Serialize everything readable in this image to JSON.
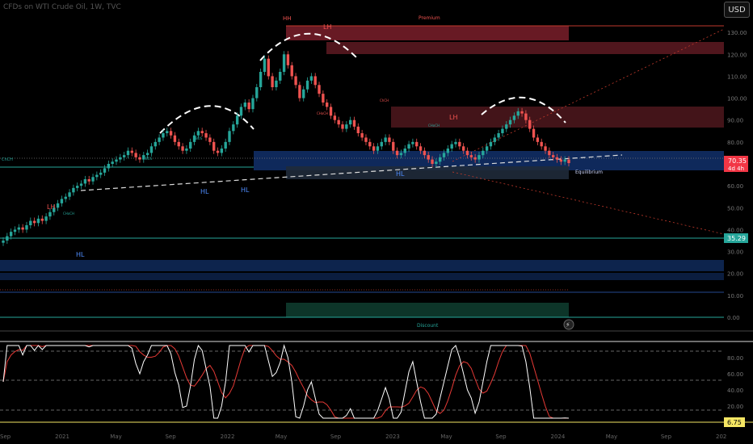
{
  "header": {
    "symbol_title": "CFDs on WTI Crude Oil, 1W, TVC",
    "currency_button": "USD"
  },
  "colors": {
    "up_candle": "#26a69a",
    "down_candle": "#ef5350",
    "premium_zone": "#7a1f2a",
    "discount_zone": "#0e3b2e",
    "equilibrium_zone": "#12306b",
    "oscillator_fast": "#ffffff",
    "oscillator_slow": "#e53935",
    "last_price_badge": "#f23645",
    "level_badge": "#26a69a",
    "osc_badge": "#f5e663"
  },
  "chart_data": {
    "type": "candlestick",
    "price_axis": {
      "ticks": [
        "130.00",
        "120.00",
        "110.00",
        "100.00",
        "90.00",
        "80.00",
        "70.00",
        "60.00",
        "50.00",
        "40.00",
        "30.00",
        "20.00",
        "10.00",
        "0.00"
      ],
      "ylim": [
        0,
        133
      ]
    },
    "time_axis": {
      "ticks": [
        "Sep",
        "2021",
        "May",
        "Sep",
        "2022",
        "May",
        "Sep",
        "2023",
        "May",
        "Sep",
        "2024",
        "May",
        "Sep",
        "202"
      ]
    },
    "last_price": {
      "value": "70.35",
      "countdown": "4d 4h"
    },
    "level_badge": "35.29",
    "oscillator": {
      "ticks": [
        "80.00",
        "60.00",
        "40.00",
        "20.00"
      ],
      "last_value": "6.75",
      "ylim": [
        0,
        100
      ]
    },
    "zone_labels": {
      "premium": "Premium",
      "discount": "Discount",
      "equilibrium": "Equilibrium"
    },
    "structure_labels": {
      "hh": "HH",
      "lh": "LH",
      "hl": "HL",
      "choch": "CHoCH",
      "bos": "BOS",
      "choch_short": "ChCH"
    },
    "close_series": [
      35,
      37,
      39,
      40,
      41,
      40,
      42,
      44,
      43,
      45,
      44,
      46,
      48,
      50,
      52,
      54,
      55,
      57,
      59,
      60,
      61,
      63,
      62,
      64,
      65,
      66,
      68,
      70,
      71,
      72,
      73,
      74,
      76,
      75,
      73,
      72,
      74,
      75,
      78,
      80,
      82,
      84,
      85,
      83,
      80,
      78,
      76,
      77,
      80,
      83,
      85,
      84,
      82,
      80,
      76,
      75,
      77,
      80,
      85,
      88,
      92,
      96,
      98,
      95,
      100,
      105,
      112,
      118,
      110,
      105,
      108,
      112,
      120,
      115,
      110,
      106,
      100,
      104,
      108,
      110,
      106,
      102,
      98,
      96,
      92,
      90,
      88,
      86,
      88,
      90,
      87,
      84,
      82,
      80,
      78,
      76,
      78,
      80,
      82,
      80,
      76,
      74,
      75,
      77,
      79,
      80,
      78,
      76,
      74,
      72,
      70,
      71,
      73,
      75,
      77,
      79,
      80,
      78,
      76,
      74,
      73,
      72,
      74,
      76,
      78,
      80,
      82,
      84,
      86,
      88,
      90,
      92,
      94,
      93,
      90,
      86,
      82,
      80,
      78,
      76,
      74,
      73,
      72,
      71,
      72,
      70.35
    ]
  }
}
